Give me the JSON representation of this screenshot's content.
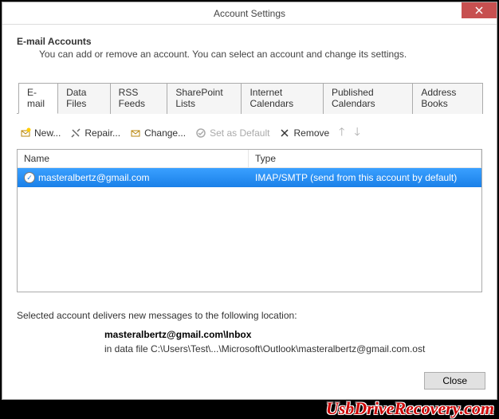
{
  "window": {
    "title": "Account Settings"
  },
  "header": {
    "heading": "E-mail Accounts",
    "subheading": "You can add or remove an account. You can select an account and change its settings."
  },
  "tabs": [
    {
      "label": "E-mail",
      "active": true
    },
    {
      "label": "Data Files"
    },
    {
      "label": "RSS Feeds"
    },
    {
      "label": "SharePoint Lists"
    },
    {
      "label": "Internet Calendars"
    },
    {
      "label": "Published Calendars"
    },
    {
      "label": "Address Books"
    }
  ],
  "toolbar": {
    "new": "New...",
    "repair": "Repair...",
    "change": "Change...",
    "set_default": "Set as Default",
    "remove": "Remove"
  },
  "list": {
    "col_name": "Name",
    "col_type": "Type",
    "rows": [
      {
        "name": "masteralbertz@gmail.com",
        "type": "IMAP/SMTP (send from this account by default)",
        "selected": true
      }
    ]
  },
  "footer": {
    "delivers": "Selected account delivers new messages to the following location:",
    "location": "masteralbertz@gmail.com\\Inbox",
    "path": "in data file C:\\Users\\Test\\...\\Microsoft\\Outlook\\masteralbertz@gmail.com.ost"
  },
  "buttons": {
    "close": "Close"
  },
  "watermark": "UsbDriveRecovery.com"
}
